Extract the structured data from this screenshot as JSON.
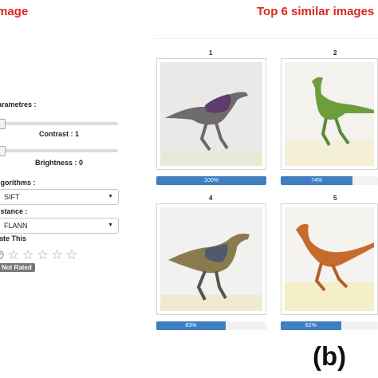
{
  "header": {
    "left_title": "mage",
    "right_title": "Top 6 similar images"
  },
  "controls": {
    "parameters_label": "arametres :",
    "contrast_label": "Contrast : 1",
    "brightness_label": "Brightness : 0",
    "algorithms_label": "lgorithms :",
    "algorithm_value": "SIFT",
    "distance_label": "istance :",
    "distance_value": "FLANN",
    "rate_label": "ate This",
    "rating_badge": "Not Rated",
    "contrast_value": 1,
    "brightness_value": 0
  },
  "results": [
    {
      "rank": "1",
      "score_label": "100%",
      "score": 1.0
    },
    {
      "rank": "2",
      "score_label": "74%",
      "score": 0.74
    },
    {
      "rank": "4",
      "score_label": "63%",
      "score": 0.63
    },
    {
      "rank": "5",
      "score_label": "62%",
      "score": 0.62
    }
  ],
  "figure_label": "(b)",
  "colors": {
    "accent_red": "#d9261c",
    "progress_blue": "#3f7fc1"
  }
}
